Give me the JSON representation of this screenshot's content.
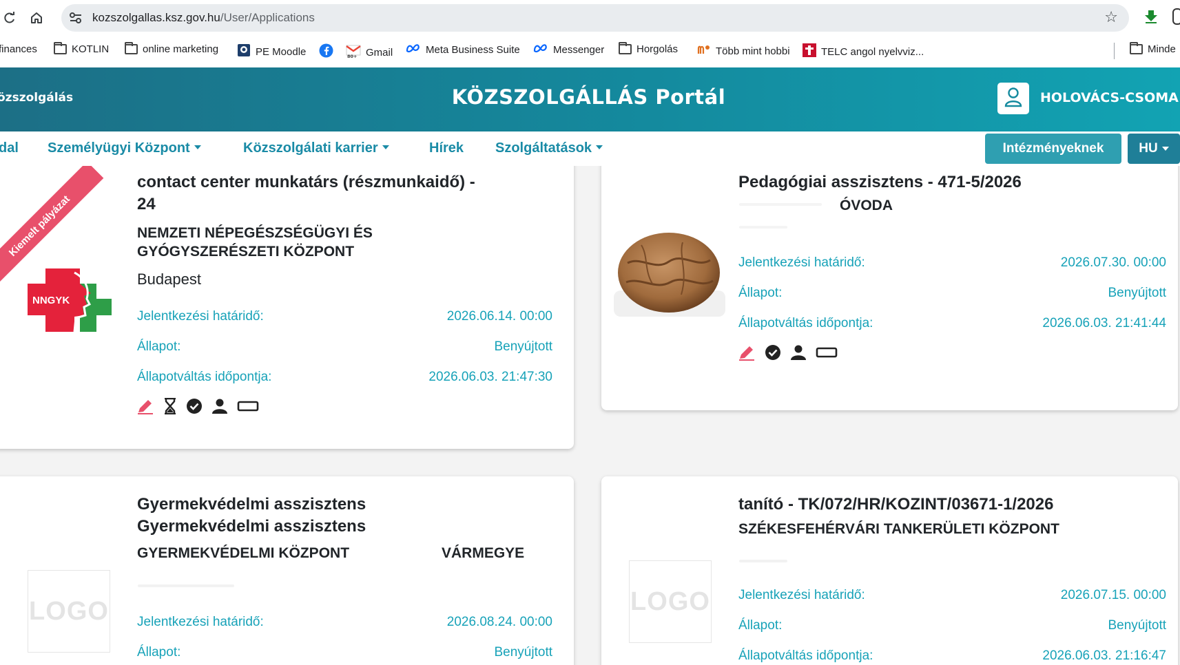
{
  "browser": {
    "url_host": "kozszolgallas.ksz.gov.hu",
    "url_path": "/User/Applications",
    "bookmarks": [
      "finances",
      "KOTLIN",
      "online marketing",
      "PE Moodle",
      "Gmail",
      "Meta Business Suite",
      "Messenger",
      "Horgolás",
      "Több mint hobbi",
      "TELC angol nyelvviz...",
      "Minde"
    ]
  },
  "header": {
    "brand": "özszolgálás",
    "title": "KÖZSZOLGÁLLÁS Portál",
    "user": "HOLOVÁCS-CSOMA"
  },
  "menu": {
    "items": [
      "dal",
      "Személyügyi Központ",
      "Közszolgálati karrier",
      "Hírek",
      "Szolgáltatások"
    ],
    "institutions": "Intézményeknek",
    "lang": "HU"
  },
  "labels": {
    "deadline": "Jelentkezési határidő:",
    "status": "Állapot:",
    "status_change": "Állapotváltás időpontja:"
  },
  "cards": [
    {
      "ribbon": "Kiemelt pályázat",
      "logo_text": "NNGYK",
      "title1": "contact center munkatárs (részmunkaidő) -",
      "title2": "24",
      "org1": "NEMZETI NÉPEGÉSZSÉGÜGYI ÉS",
      "org2": "GYÓGYSZERÉSZETI KÖZPONT",
      "city": "Budapest",
      "deadline": "2026.06.14. 00:00",
      "status": "Benyújtott",
      "status_change": "2026.06.03. 21:47:30"
    },
    {
      "title1": "Pedagógiai asszisztens - 471-5/2026",
      "org1": "ÓVODA",
      "deadline": "2026.07.30. 00:00",
      "status": "Benyújtott",
      "status_change": "2026.06.03. 21:41:44"
    },
    {
      "logo_text": "LOGO",
      "title1": "Gyermekvédelmi asszisztens",
      "title2": "Gyermekvédelmi asszisztens",
      "org1": "GYERMEKVÉDELMI KÖZPONT",
      "org1b": "VÁRMEGYE",
      "deadline": "2026.08.24. 00:00",
      "status": "Benyújtott"
    },
    {
      "logo_text": "LOGO",
      "title1": "tanító - TK/072/HR/KOZINT/03671-1/2026",
      "org1": "SZÉKESFEHÉRVÁRI TANKERÜLETI KÖZPONT",
      "deadline": "2026.07.15. 00:00",
      "status": "Benyújtott",
      "status_change": "2026.06.03. 21:16:47"
    }
  ],
  "colors": {
    "accent": "#17a2b8",
    "ribbon": "#e8506b",
    "header_start": "#1c6f86",
    "header_end": "#12a3b3"
  }
}
